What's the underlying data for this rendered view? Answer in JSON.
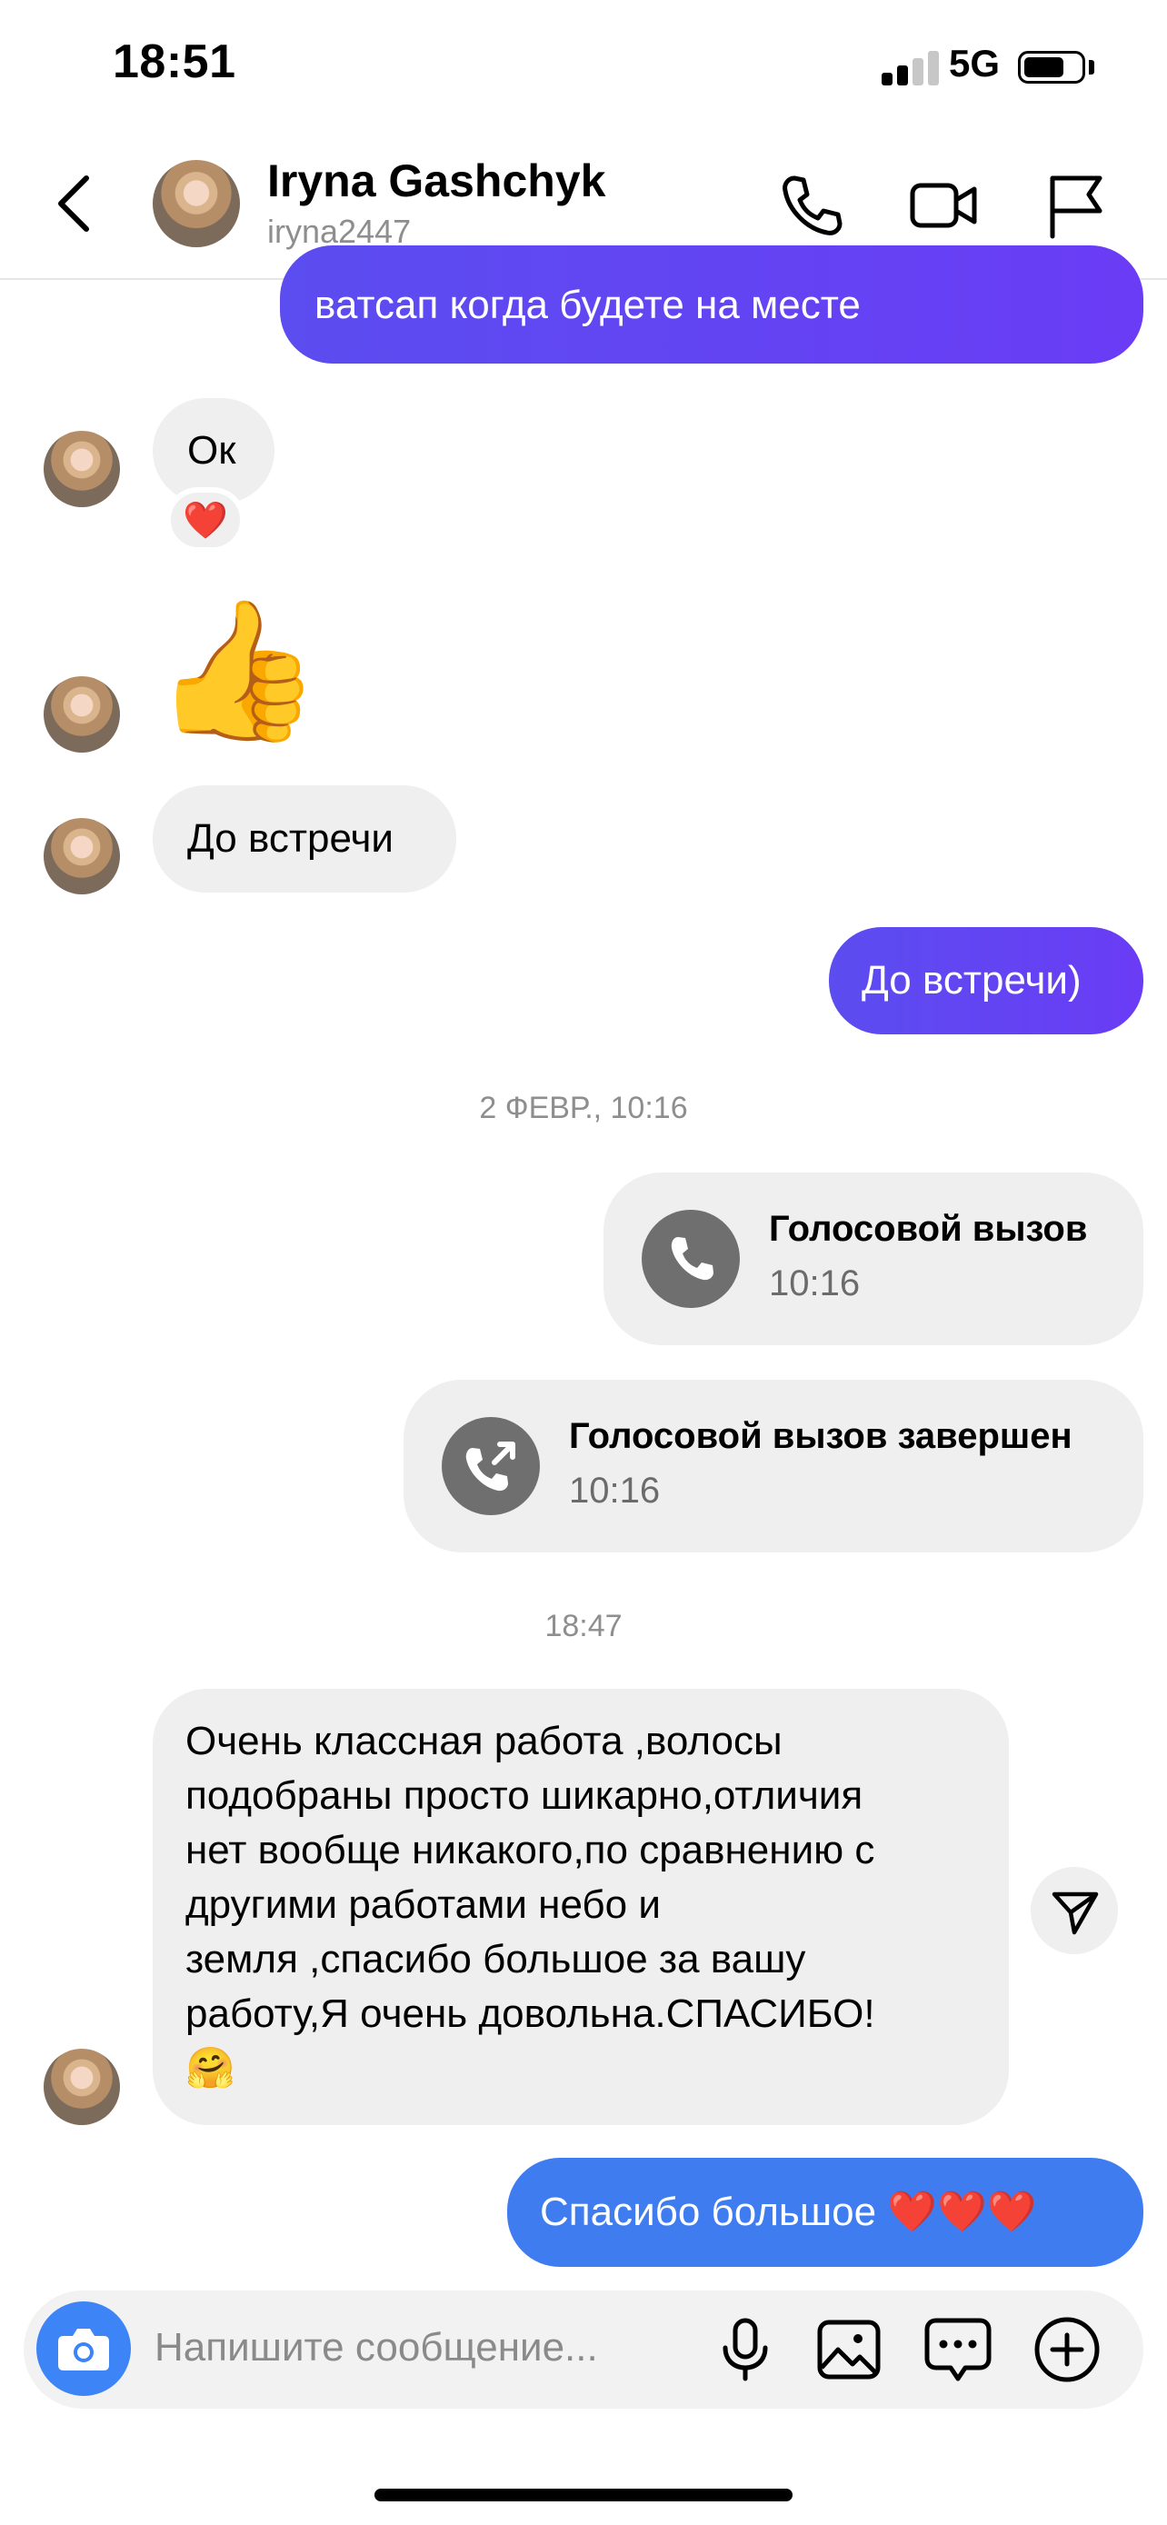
{
  "status_bar": {
    "time": "18:51",
    "network": "5G",
    "battery_level": 0.72
  },
  "header": {
    "name": "Iryna Gashchyk",
    "username": "iryna2447"
  },
  "messages": {
    "m0_text": "ватсап когда будете на месте",
    "m1_text": "Ок",
    "m1_reaction": "❤️",
    "m2_emoji": "👍",
    "m3_text": "До встречи",
    "m4_text": "До встречи)",
    "date_divider": "2 ФЕВР., 10:16",
    "call1_title": "Голосовой вызов",
    "call1_time": "10:16",
    "call2_title": "Голосовой вызов завершен",
    "call2_time": "10:16",
    "time_divider": "18:47",
    "m5_text": "Очень классная работа ,волосы\nподобраны просто шикарно,отличия\nнет вообще никакого,по сравнению с\nдругими работами небо и\nземля ,спасибо большое за вашу\nработу,Я очень довольна.СПАСИБО!\n🤗",
    "m6_text": "Спасибо большое ❤️❤️❤️"
  },
  "composer": {
    "placeholder": "Напишите сообщение..."
  },
  "icons": {
    "header": [
      "back-icon",
      "phone-icon",
      "video-camera-icon",
      "flag-icon"
    ],
    "composer": [
      "camera-icon",
      "microphone-icon",
      "image-icon",
      "sticker-chat-icon",
      "plus-icon"
    ]
  },
  "colors": {
    "outgoing_purple": "#6a3cf5",
    "outgoing_blue": "#3f7cf0",
    "incoming_bg": "#efefef",
    "camera_blue": "#3d85f6"
  }
}
